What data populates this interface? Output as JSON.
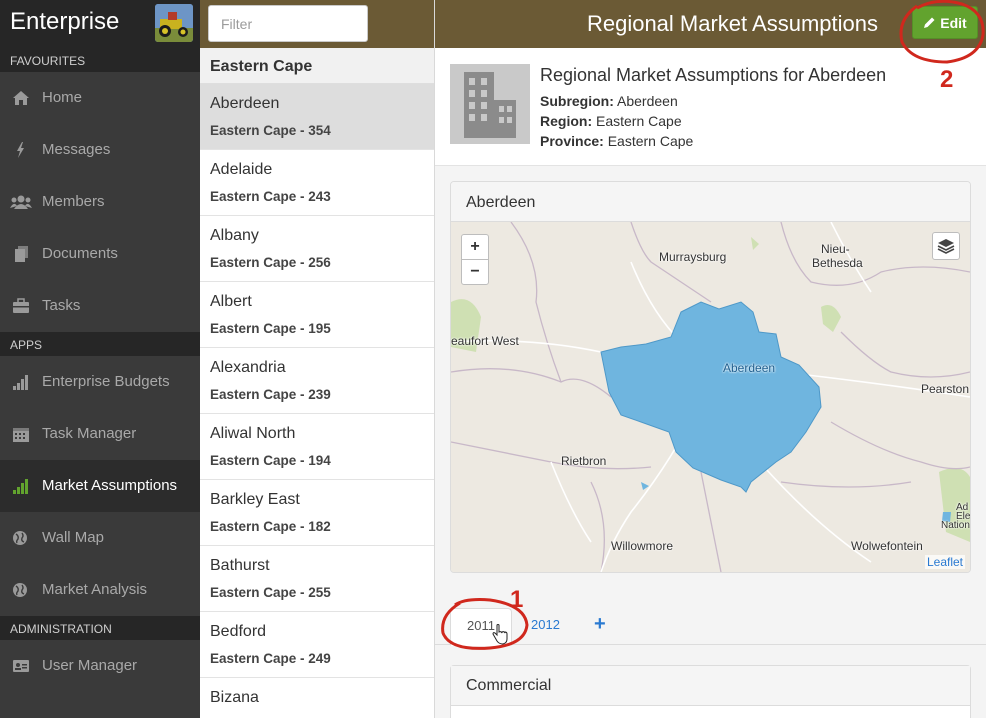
{
  "colors": {
    "sidebar_bg": "#3a3a3a",
    "sidebar_header_bg": "#262626",
    "topbar_bg": "#6b5a35",
    "accent_green": "#62a32e",
    "link_blue": "#2a7ad1",
    "region_fill": "#6fb5df",
    "annotation_red": "#d0281d"
  },
  "sidebar": {
    "brand": "Enterprise",
    "sections": [
      {
        "title": "FAVOURITES",
        "items": [
          {
            "label": "Home",
            "icon": "home-icon"
          },
          {
            "label": "Messages",
            "icon": "bolt-icon"
          },
          {
            "label": "Members",
            "icon": "users-icon"
          },
          {
            "label": "Documents",
            "icon": "documents-icon"
          },
          {
            "label": "Tasks",
            "icon": "briefcase-icon"
          }
        ]
      },
      {
        "title": "APPS",
        "items": [
          {
            "label": "Enterprise Budgets",
            "icon": "bar-chart-icon"
          },
          {
            "label": "Task Manager",
            "icon": "calendar-icon"
          },
          {
            "label": "Market Assumptions",
            "icon": "bar-chart-icon",
            "active": true
          },
          {
            "label": "Wall Map",
            "icon": "globe-icon"
          },
          {
            "label": "Market Analysis",
            "icon": "globe-icon"
          }
        ]
      },
      {
        "title": "ADMINISTRATION",
        "items": [
          {
            "label": "User Manager",
            "icon": "user-card-icon"
          }
        ]
      }
    ]
  },
  "list_panel": {
    "filter_placeholder": "Filter",
    "group": "Eastern Cape",
    "items": [
      {
        "name": "Aberdeen",
        "sub": "Eastern Cape - 354",
        "selected": true
      },
      {
        "name": "Adelaide",
        "sub": "Eastern Cape - 243"
      },
      {
        "name": "Albany",
        "sub": "Eastern Cape - 256"
      },
      {
        "name": "Albert",
        "sub": "Eastern Cape - 195"
      },
      {
        "name": "Alexandria",
        "sub": "Eastern Cape - 239"
      },
      {
        "name": "Aliwal North",
        "sub": "Eastern Cape - 194"
      },
      {
        "name": "Barkley East",
        "sub": "Eastern Cape - 182"
      },
      {
        "name": "Bathurst",
        "sub": "Eastern Cape - 255"
      },
      {
        "name": "Bedford",
        "sub": "Eastern Cape - 249"
      },
      {
        "name": "Bizana",
        "sub": ""
      }
    ]
  },
  "main": {
    "page_title": "Regional Market Assumptions",
    "edit_label": "Edit",
    "detail": {
      "title": "Regional Market Assumptions for Aberdeen",
      "subregion_label": "Subregion:",
      "subregion": "Aberdeen",
      "region_label": "Region:",
      "region": "Eastern Cape",
      "province_label": "Province:",
      "province": "Eastern Cape"
    },
    "map": {
      "heading": "Aberdeen",
      "zoom_in": "+",
      "zoom_out": "−",
      "attribution": "Leaflet",
      "places": {
        "nieu_bethesda_1": "Nieu-",
        "nieu_bethesda_2": "Bethesda",
        "murraysburg": "Murraysburg",
        "beaufort_west": "eaufort West",
        "aberdeen": "Aberdeen",
        "pearston": "Pearston",
        "rietbron": "Rietbron",
        "willowmore": "Willowmore",
        "wolwefontein": "Wolwefontein",
        "edge_ad": "Ad",
        "edge_ele": "Ele",
        "edge_nation": "Nation"
      }
    },
    "tabs": {
      "active": "2011",
      "other": "2012",
      "add": "+"
    },
    "section_heading": "Commercial",
    "annotations": {
      "one": "1",
      "two": "2"
    }
  }
}
